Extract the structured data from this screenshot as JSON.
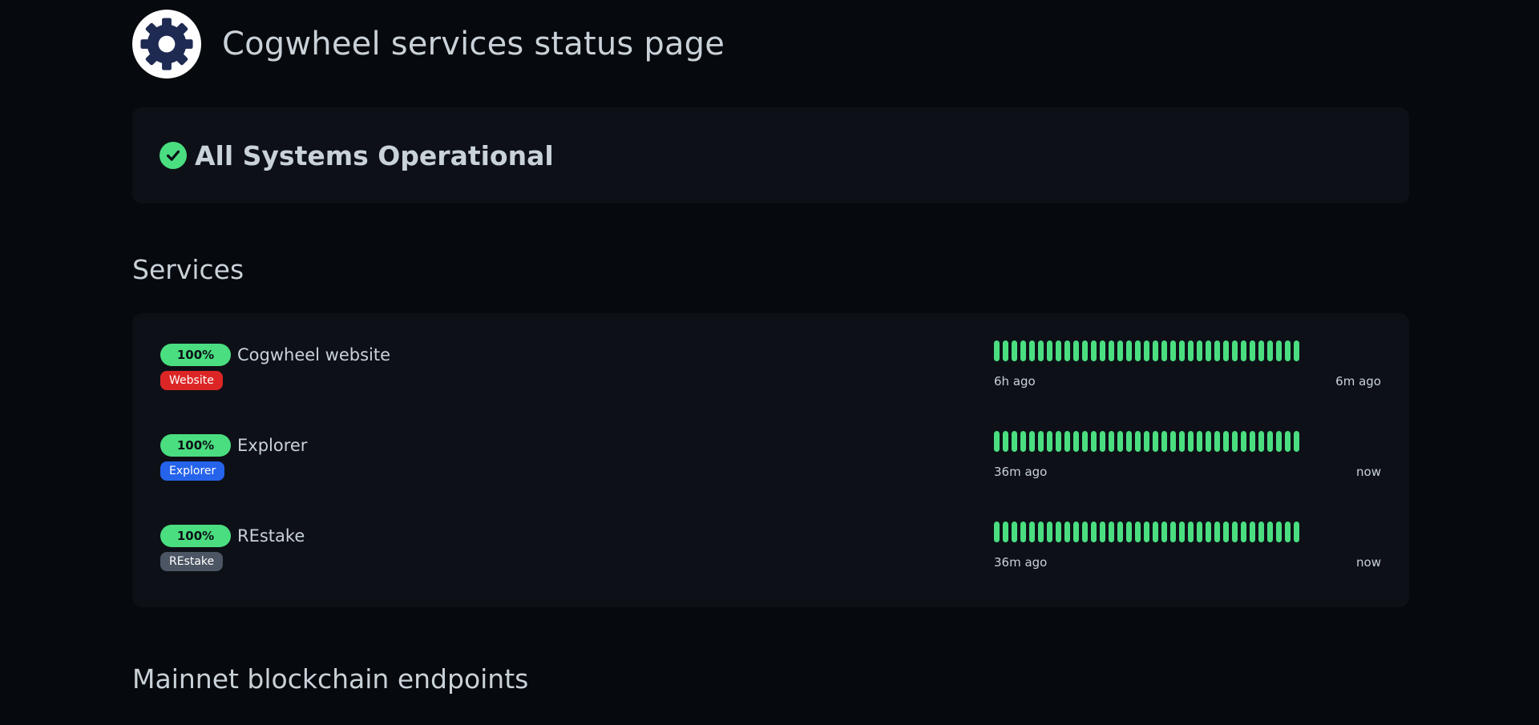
{
  "header": {
    "title": "Cogwheel services status page",
    "logo_icon": "cogwheel-icon"
  },
  "overall_status": {
    "text": "All Systems Operational",
    "icon": "check-circle-icon",
    "color": "#4ade80"
  },
  "sections": {
    "services_title": "Services",
    "mainnet_title": "Mainnet blockchain endpoints"
  },
  "services": [
    {
      "uptime": "100%",
      "name": "Cogwheel website",
      "tag": "Website",
      "tag_color": "#dc2626",
      "time_start": "6h ago",
      "time_end": "6m ago"
    },
    {
      "uptime": "100%",
      "name": "Explorer",
      "tag": "Explorer",
      "tag_color": "#2563eb",
      "time_start": "36m ago",
      "time_end": "now"
    },
    {
      "uptime": "100%",
      "name": "REstake",
      "tag": "REstake",
      "tag_color": "#4b5563",
      "time_start": "36m ago",
      "time_end": "now"
    }
  ],
  "colors": {
    "background": "#06090d",
    "card": "#0d1117",
    "text": "#c9d1d9",
    "up": "#4ade80"
  }
}
